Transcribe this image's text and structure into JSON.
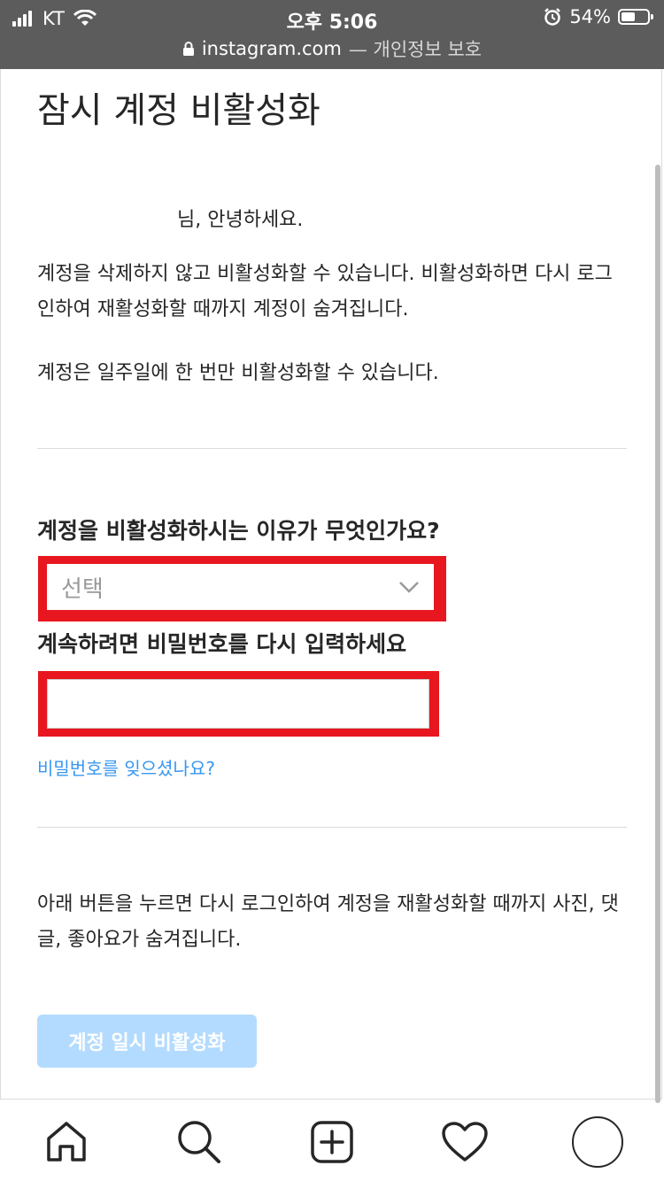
{
  "status_bar": {
    "carrier": "KT",
    "time": "오후 5:06",
    "battery": "54%",
    "battery_level": 0.54
  },
  "url_bar": {
    "domain": "instagram.com",
    "suffix": "— 개인정보 보호"
  },
  "page": {
    "title": "잠시 계정 비활성화",
    "greeting": "님, 안녕하세요.",
    "para1": "계정을 삭제하지 않고 비활성화할 수 있습니다. 비활성화하면 다시 로그인하여 재활성화할 때까지 계정이 숨겨집니다.",
    "para2": "계정은 일주일에 한 번만 비활성화할 수 있습니다.",
    "reason_label": "계정을 비활성화하시는 이유가 무엇인가요?",
    "reason_select_value": "선택",
    "password_label": "계속하려면 비밀번호를 다시 입력하세요",
    "password_value": "",
    "forgot_link": "비밀번호를 잊으셨나요?",
    "footer_note": "아래 버튼을 누르면 다시 로그인하여 계정을 재활성화할 때까지 사진, 댓글, 좋아요가 숨겨집니다.",
    "submit_label": "계정 일시 비활성화"
  },
  "tab_bar": {
    "icons": [
      "home-icon",
      "search-icon",
      "new-post-icon",
      "activity-heart-icon",
      "profile-avatar"
    ]
  },
  "colors": {
    "highlight": "#e8161e",
    "link": "#3897f0",
    "button_disabled": "#b3dbff",
    "status_bar_bg": "#5c5c5c"
  }
}
